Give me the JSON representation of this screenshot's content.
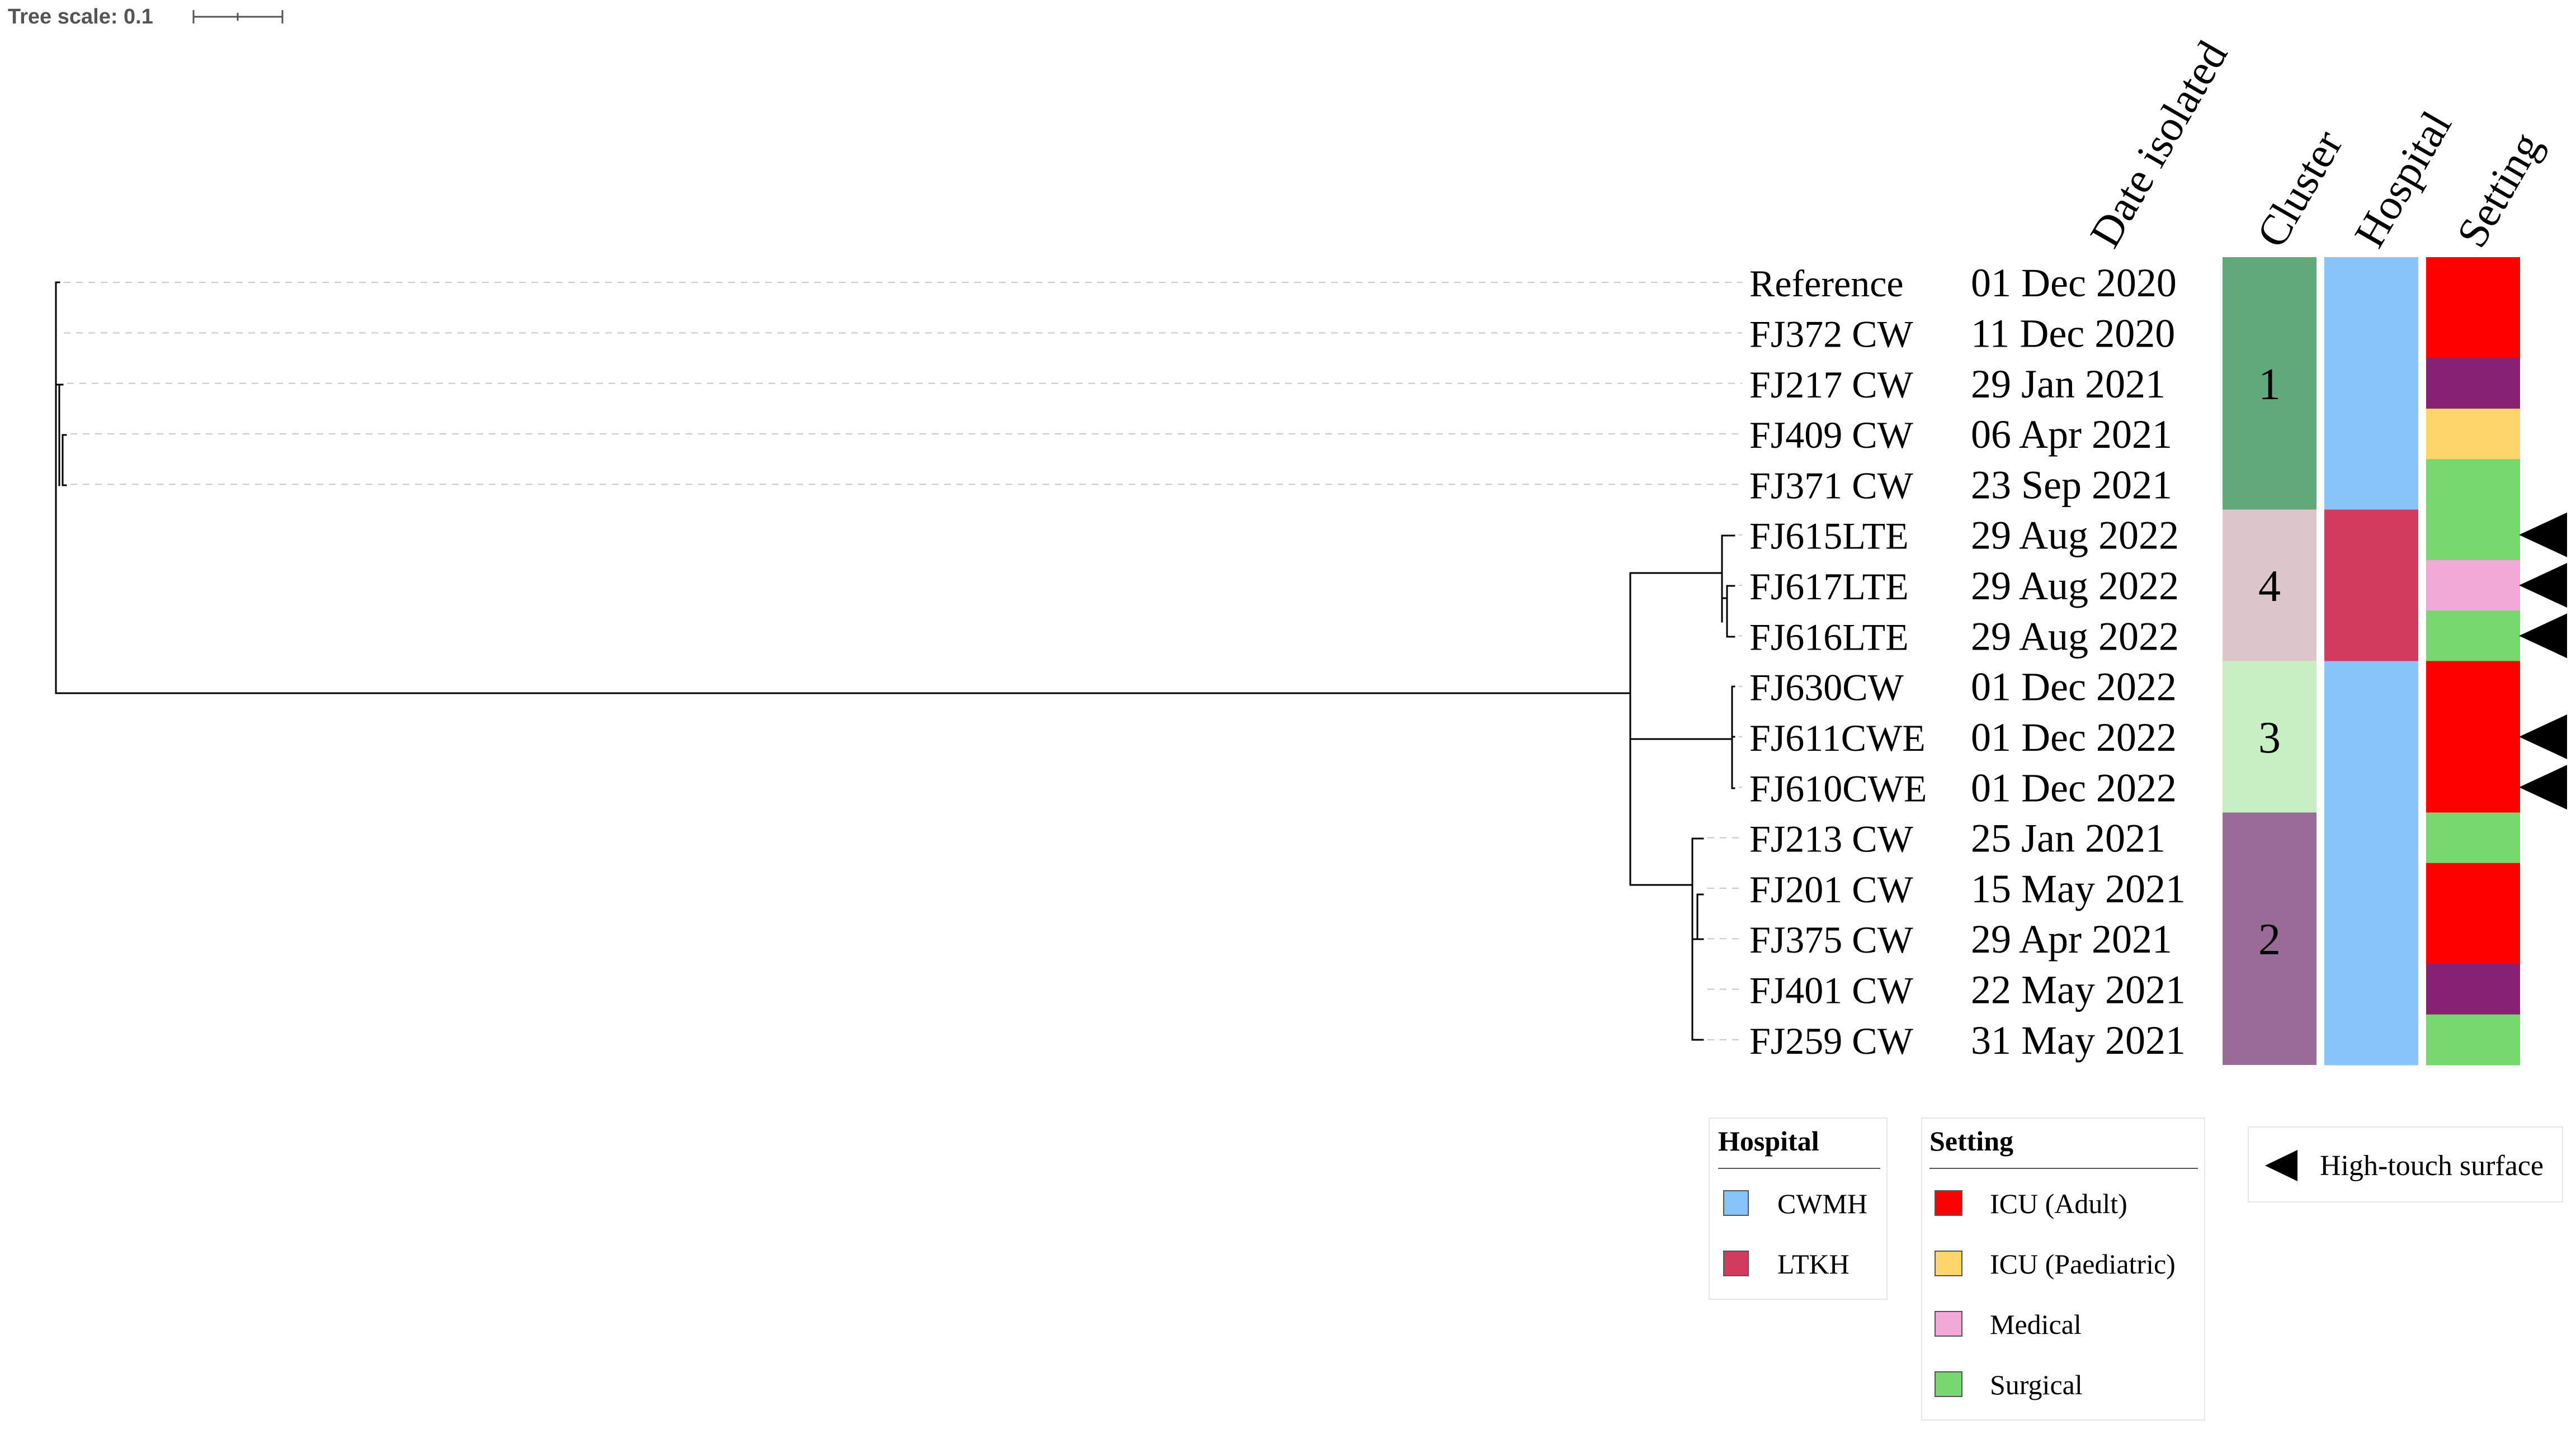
{
  "tree_scale": {
    "label": "Tree scale: 0.1"
  },
  "columns": {
    "date": "Date isolated",
    "cluster": "Cluster",
    "hospital": "Hospital",
    "setting": "Setting"
  },
  "isolates": [
    {
      "name": "Reference",
      "date": "01 Dec 2020",
      "cluster": "1",
      "hospital": "CWMH",
      "setting": "ICU (Adult)",
      "high_touch": false
    },
    {
      "name": "FJ372 CW",
      "date": "11 Dec 2020",
      "cluster": "1",
      "hospital": "CWMH",
      "setting": "ICU (Adult)",
      "high_touch": false
    },
    {
      "name": "FJ217 CW",
      "date": "29 Jan 2021",
      "cluster": "1",
      "hospital": "CWMH",
      "setting": "",
      "high_touch": false
    },
    {
      "name": "FJ409 CW",
      "date": "06 Apr 2021",
      "cluster": "1",
      "hospital": "CWMH",
      "setting": "ICU (Paediatric)",
      "high_touch": false
    },
    {
      "name": "FJ371 CW",
      "date": "23 Sep 2021",
      "cluster": "1",
      "hospital": "CWMH",
      "setting": "Surgical",
      "high_touch": false
    },
    {
      "name": "FJ615LTE",
      "date": "29 Aug 2022",
      "cluster": "4",
      "hospital": "LTKH",
      "setting": "Surgical",
      "high_touch": true
    },
    {
      "name": "FJ617LTE",
      "date": "29 Aug 2022",
      "cluster": "4",
      "hospital": "LTKH",
      "setting": "Medical",
      "high_touch": true
    },
    {
      "name": "FJ616LTE",
      "date": "29 Aug 2022",
      "cluster": "4",
      "hospital": "LTKH",
      "setting": "Surgical",
      "high_touch": true
    },
    {
      "name": "FJ630CW",
      "date": "01 Dec 2022",
      "cluster": "3",
      "hospital": "CWMH",
      "setting": "ICU (Adult)",
      "high_touch": false
    },
    {
      "name": "FJ611CWE",
      "date": "01 Dec 2022",
      "cluster": "3",
      "hospital": "CWMH",
      "setting": "ICU (Adult)",
      "high_touch": true
    },
    {
      "name": "FJ610CWE",
      "date": "01 Dec 2022",
      "cluster": "3",
      "hospital": "CWMH",
      "setting": "ICU (Adult)",
      "high_touch": true
    },
    {
      "name": "FJ213 CW",
      "date": "25 Jan 2021",
      "cluster": "2",
      "hospital": "CWMH",
      "setting": "Surgical",
      "high_touch": false
    },
    {
      "name": "FJ201 CW",
      "date": "15 May 2021",
      "cluster": "2",
      "hospital": "CWMH",
      "setting": "ICU (Adult)",
      "high_touch": false
    },
    {
      "name": "FJ375 CW",
      "date": "29 Apr 2021",
      "cluster": "2",
      "hospital": "CWMH",
      "setting": "ICU (Adult)",
      "high_touch": false
    },
    {
      "name": "FJ401 CW",
      "date": "22 May 2021",
      "cluster": "2",
      "hospital": "CWMH",
      "setting": "",
      "high_touch": false
    },
    {
      "name": "FJ259 CW",
      "date": "31 May 2021",
      "cluster": "2",
      "hospital": "CWMH",
      "setting": "Surgical",
      "high_touch": false
    }
  ],
  "clusters": [
    {
      "label": "1",
      "color": "#61a87a"
    },
    {
      "label": "4",
      "color": "#dcc5cb"
    },
    {
      "label": "3",
      "color": "#c8efc4"
    },
    {
      "label": "2",
      "color": "#9a6a98"
    }
  ],
  "colors": {
    "CWMH": "#88c4fa",
    "LTKH": "#d23b5e",
    "ICU (Adult)": "#ff0000",
    "ICU (Paediatric)": "#fdd56a",
    "Medical": "#f2a9d8",
    "Surgical": "#76d86e",
    "unlabelled_setting": "#862173",
    "high_touch": "#000000",
    "branch": "#000000",
    "guide": "#c8c8c8"
  },
  "legends": {
    "hospital": {
      "title": "Hospital",
      "items": [
        "CWMH",
        "LTKH"
      ]
    },
    "setting": {
      "title": "Setting",
      "items": [
        "ICU (Adult)",
        "ICU (Paediatric)",
        "Medical",
        "Surgical"
      ]
    },
    "marker": {
      "label": "High-touch surface"
    }
  }
}
